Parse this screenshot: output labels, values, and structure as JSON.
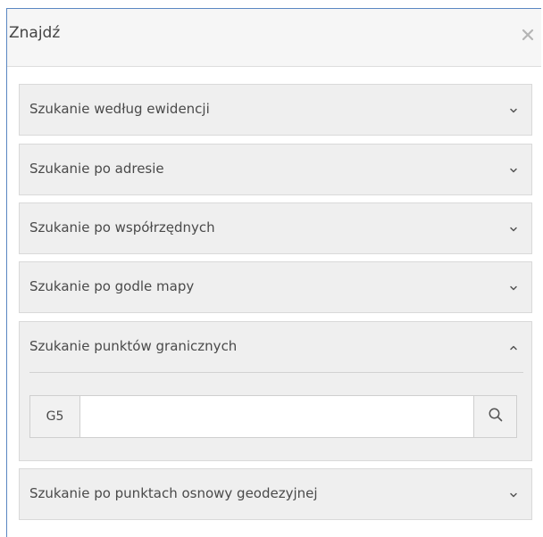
{
  "panel": {
    "title": "Znajdź",
    "close_icon": "close-icon"
  },
  "sections": [
    {
      "label": "Szukanie według ewidencji",
      "expanded": false,
      "icon": "chevron-down-icon"
    },
    {
      "label": "Szukanie po adresie",
      "expanded": false,
      "icon": "chevron-down-icon"
    },
    {
      "label": "Szukanie po współrzędnych",
      "expanded": false,
      "icon": "chevron-down-icon"
    },
    {
      "label": "Szukanie po godle mapy",
      "expanded": false,
      "icon": "chevron-down-icon"
    },
    {
      "label": "Szukanie punktów granicznych",
      "expanded": true,
      "icon": "chevron-up-icon",
      "search": {
        "prefix": "G5",
        "value": "",
        "placeholder": "",
        "button_icon": "search-icon"
      }
    },
    {
      "label": "Szukanie po punktach osnowy geodezyjnej",
      "expanded": false,
      "icon": "chevron-down-icon"
    }
  ],
  "colors": {
    "panel_border": "#5a87c2",
    "header_bg": "#f6f6f6",
    "section_bg": "#efefef",
    "text": "#444444"
  }
}
